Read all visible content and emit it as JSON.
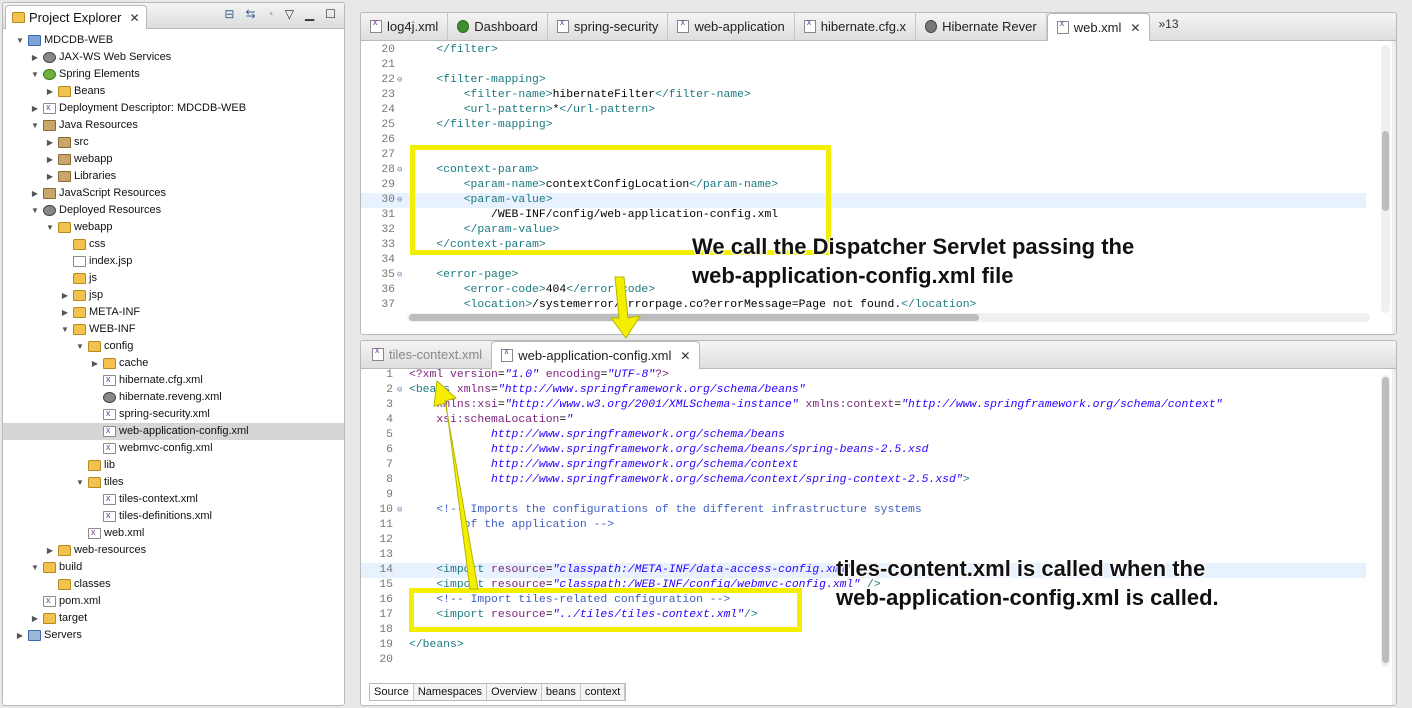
{
  "explorer": {
    "title": "Project Explorer",
    "tree": [
      {
        "label": "MDCDB-WEB",
        "depth": 0,
        "open": true,
        "icon": "proj"
      },
      {
        "label": "JAX-WS Web Services",
        "depth": 1,
        "open": false,
        "icon": "gear"
      },
      {
        "label": "Spring Elements",
        "depth": 1,
        "open": true,
        "icon": "spring"
      },
      {
        "label": "Beans",
        "depth": 2,
        "open": false,
        "icon": "folder"
      },
      {
        "label": "Deployment Descriptor: MDCDB-WEB",
        "depth": 1,
        "open": false,
        "icon": "xml"
      },
      {
        "label": "Java Resources",
        "depth": 1,
        "open": true,
        "icon": "pkg"
      },
      {
        "label": "src",
        "depth": 2,
        "open": false,
        "icon": "pkg"
      },
      {
        "label": "webapp",
        "depth": 2,
        "open": false,
        "icon": "pkg"
      },
      {
        "label": "Libraries",
        "depth": 2,
        "open": false,
        "icon": "pkg"
      },
      {
        "label": "JavaScript Resources",
        "depth": 1,
        "open": false,
        "icon": "pkg"
      },
      {
        "label": "Deployed Resources",
        "depth": 1,
        "open": true,
        "icon": "gear"
      },
      {
        "label": "webapp",
        "depth": 2,
        "open": true,
        "icon": "folder"
      },
      {
        "label": "css",
        "depth": 3,
        "open": null,
        "icon": "folder"
      },
      {
        "label": "index.jsp",
        "depth": 3,
        "open": null,
        "icon": "jsp"
      },
      {
        "label": "js",
        "depth": 3,
        "open": null,
        "icon": "folder"
      },
      {
        "label": "jsp",
        "depth": 3,
        "open": false,
        "icon": "folder"
      },
      {
        "label": "META-INF",
        "depth": 3,
        "open": false,
        "icon": "folder"
      },
      {
        "label": "WEB-INF",
        "depth": 3,
        "open": true,
        "icon": "folder"
      },
      {
        "label": "config",
        "depth": 4,
        "open": true,
        "icon": "folder"
      },
      {
        "label": "cache",
        "depth": 5,
        "open": false,
        "icon": "folder"
      },
      {
        "label": "hibernate.cfg.xml",
        "depth": 5,
        "open": null,
        "icon": "xml"
      },
      {
        "label": "hibernate.reveng.xml",
        "depth": 5,
        "open": null,
        "icon": "gear"
      },
      {
        "label": "spring-security.xml",
        "depth": 5,
        "open": null,
        "icon": "xml"
      },
      {
        "label": "web-application-config.xml",
        "depth": 5,
        "open": null,
        "icon": "xml",
        "selected": true
      },
      {
        "label": "webmvc-config.xml",
        "depth": 5,
        "open": null,
        "icon": "xml"
      },
      {
        "label": "lib",
        "depth": 4,
        "open": null,
        "icon": "folder"
      },
      {
        "label": "tiles",
        "depth": 4,
        "open": true,
        "icon": "folder"
      },
      {
        "label": "tiles-context.xml",
        "depth": 5,
        "open": null,
        "icon": "xml"
      },
      {
        "label": "tiles-definitions.xml",
        "depth": 5,
        "open": null,
        "icon": "xml"
      },
      {
        "label": "web.xml",
        "depth": 4,
        "open": null,
        "icon": "xml"
      },
      {
        "label": "web-resources",
        "depth": 2,
        "open": false,
        "icon": "folder"
      },
      {
        "label": "build",
        "depth": 1,
        "open": true,
        "icon": "folder"
      },
      {
        "label": "classes",
        "depth": 2,
        "open": null,
        "icon": "folder"
      },
      {
        "label": "pom.xml",
        "depth": 1,
        "open": null,
        "icon": "xml"
      },
      {
        "label": "target",
        "depth": 1,
        "open": false,
        "icon": "folder"
      },
      {
        "label": "Servers",
        "depth": 0,
        "open": false,
        "icon": "server"
      }
    ]
  },
  "editor_top": {
    "tabs": [
      {
        "label": "log4j.xml",
        "icon": "xml",
        "active": false
      },
      {
        "label": "Dashboard",
        "icon": "dash",
        "active": false
      },
      {
        "label": "spring-security",
        "icon": "xml",
        "active": false
      },
      {
        "label": "web-application",
        "icon": "xml",
        "active": false
      },
      {
        "label": "hibernate.cfg.x",
        "icon": "xml",
        "active": false
      },
      {
        "label": "Hibernate Rever",
        "icon": "gear",
        "active": false
      },
      {
        "label": "web.xml",
        "icon": "xml",
        "active": true
      }
    ],
    "overflow": "»13",
    "lines": [
      {
        "n": "20",
        "fold": false,
        "hl": false,
        "segs": [
          [
            "pl",
            "    "
          ],
          [
            "tag",
            "</filter>"
          ]
        ]
      },
      {
        "n": "21",
        "fold": false,
        "hl": false,
        "segs": []
      },
      {
        "n": "22",
        "fold": true,
        "hl": false,
        "segs": [
          [
            "pl",
            "    "
          ],
          [
            "tag",
            "<filter-mapping>"
          ]
        ]
      },
      {
        "n": "23",
        "fold": false,
        "hl": false,
        "segs": [
          [
            "pl",
            "        "
          ],
          [
            "tag",
            "<filter-name>"
          ],
          [
            "pl",
            "hibernateFilter"
          ],
          [
            "tag",
            "</filter-name>"
          ]
        ]
      },
      {
        "n": "24",
        "fold": false,
        "hl": false,
        "segs": [
          [
            "pl",
            "        "
          ],
          [
            "tag",
            "<url-pattern>"
          ],
          [
            "pl",
            "*"
          ],
          [
            "tag",
            "</url-pattern>"
          ]
        ]
      },
      {
        "n": "25",
        "fold": false,
        "hl": false,
        "segs": [
          [
            "pl",
            "    "
          ],
          [
            "tag",
            "</filter-mapping>"
          ]
        ]
      },
      {
        "n": "26",
        "fold": false,
        "hl": false,
        "segs": []
      },
      {
        "n": "27",
        "fold": false,
        "hl": false,
        "segs": []
      },
      {
        "n": "28",
        "fold": true,
        "hl": false,
        "segs": [
          [
            "pl",
            "    "
          ],
          [
            "tag",
            "<context-param>"
          ]
        ]
      },
      {
        "n": "29",
        "fold": false,
        "hl": false,
        "segs": [
          [
            "pl",
            "        "
          ],
          [
            "tag",
            "<param-name>"
          ],
          [
            "pl",
            "contextConfigLocation"
          ],
          [
            "tag",
            "</param-name>"
          ]
        ]
      },
      {
        "n": "30",
        "fold": true,
        "hl": true,
        "segs": [
          [
            "pl",
            "        "
          ],
          [
            "tag",
            "<param-value>"
          ]
        ]
      },
      {
        "n": "31",
        "fold": false,
        "hl": false,
        "segs": [
          [
            "pl",
            "            /WEB-INF/config/web-application-config.xml"
          ]
        ]
      },
      {
        "n": "32",
        "fold": false,
        "hl": false,
        "segs": [
          [
            "pl",
            "        "
          ],
          [
            "tag",
            "</param-value>"
          ]
        ]
      },
      {
        "n": "33",
        "fold": false,
        "hl": false,
        "segs": [
          [
            "pl",
            "    "
          ],
          [
            "tag",
            "</context-param>"
          ]
        ]
      },
      {
        "n": "34",
        "fold": false,
        "hl": false,
        "segs": []
      },
      {
        "n": "35",
        "fold": true,
        "hl": false,
        "segs": [
          [
            "pl",
            "    "
          ],
          [
            "tag",
            "<error-page>"
          ]
        ]
      },
      {
        "n": "36",
        "fold": false,
        "hl": false,
        "segs": [
          [
            "pl",
            "        "
          ],
          [
            "tag",
            "<error-code>"
          ],
          [
            "pl",
            "404"
          ],
          [
            "tag",
            "</error-code>"
          ]
        ]
      },
      {
        "n": "37",
        "fold": false,
        "hl": false,
        "segs": [
          [
            "pl",
            "        "
          ],
          [
            "tag",
            "<location>"
          ],
          [
            "pl",
            "/systemerror/errorpage.co?errorMessage=Page not found."
          ],
          [
            "tag",
            "</location>"
          ]
        ]
      }
    ]
  },
  "editor_bottom": {
    "tabs": [
      {
        "label": "tiles-context.xml",
        "icon": "xml",
        "active": false
      },
      {
        "label": "web-application-config.xml",
        "icon": "xml",
        "active": true
      }
    ],
    "lines": [
      {
        "n": "1",
        "fold": false,
        "hl": false,
        "segs": [
          [
            "pi",
            "<?xml"
          ],
          [
            "pl",
            " "
          ],
          [
            "an",
            "version"
          ],
          [
            "pl",
            "="
          ],
          [
            "av",
            "\"1.0\""
          ],
          [
            "pl",
            " "
          ],
          [
            "an",
            "encoding"
          ],
          [
            "pl",
            "="
          ],
          [
            "av",
            "\"UTF-8\""
          ],
          [
            "pi",
            "?>"
          ]
        ]
      },
      {
        "n": "2",
        "fold": true,
        "hl": false,
        "segs": [
          [
            "tag",
            "<beans"
          ],
          [
            "pl",
            " "
          ],
          [
            "an",
            "xmlns"
          ],
          [
            "pl",
            "="
          ],
          [
            "av",
            "\"http://www.springframework.org/schema/beans\""
          ]
        ]
      },
      {
        "n": "3",
        "fold": false,
        "hl": false,
        "segs": [
          [
            "pl",
            "    "
          ],
          [
            "an",
            "xmlns:xsi"
          ],
          [
            "pl",
            "="
          ],
          [
            "av",
            "\"http://www.w3.org/2001/XMLSchema-instance\""
          ],
          [
            "pl",
            " "
          ],
          [
            "an",
            "xmlns:context"
          ],
          [
            "pl",
            "="
          ],
          [
            "av",
            "\"http://www.springframework.org/schema/context\""
          ]
        ]
      },
      {
        "n": "4",
        "fold": false,
        "hl": false,
        "segs": [
          [
            "pl",
            "    "
          ],
          [
            "an",
            "xsi:schemaLocation"
          ],
          [
            "pl",
            "="
          ],
          [
            "av",
            "\""
          ]
        ]
      },
      {
        "n": "5",
        "fold": false,
        "hl": false,
        "segs": [
          [
            "av",
            "            http://www.springframework.org/schema/beans"
          ]
        ]
      },
      {
        "n": "6",
        "fold": false,
        "hl": false,
        "segs": [
          [
            "av",
            "            http://www.springframework.org/schema/beans/spring-beans-2.5.xsd"
          ]
        ]
      },
      {
        "n": "7",
        "fold": false,
        "hl": false,
        "segs": [
          [
            "av",
            "            http://www.springframework.org/schema/context"
          ]
        ]
      },
      {
        "n": "8",
        "fold": false,
        "hl": false,
        "segs": [
          [
            "av",
            "            http://www.springframework.org/schema/context/spring-context-2.5.xsd\""
          ],
          [
            "tag",
            ">"
          ]
        ]
      },
      {
        "n": "9",
        "fold": false,
        "hl": false,
        "segs": []
      },
      {
        "n": "10",
        "fold": true,
        "hl": false,
        "segs": [
          [
            "cm",
            "    <!-- Imports the configurations of the different infrastructure systems"
          ]
        ]
      },
      {
        "n": "11",
        "fold": false,
        "hl": false,
        "segs": [
          [
            "cm",
            "        of the application -->"
          ]
        ]
      },
      {
        "n": "12",
        "fold": false,
        "hl": false,
        "segs": []
      },
      {
        "n": "13",
        "fold": false,
        "hl": false,
        "segs": []
      },
      {
        "n": "14",
        "fold": false,
        "hl": true,
        "segs": [
          [
            "pl",
            "    "
          ],
          [
            "tag",
            "<import"
          ],
          [
            "pl",
            " "
          ],
          [
            "an",
            "resource"
          ],
          [
            "pl",
            "="
          ],
          [
            "av",
            "\"classpath:/META-INF/data-access-config.xml\""
          ],
          [
            "pl",
            " "
          ],
          [
            "tag",
            "/>"
          ]
        ]
      },
      {
        "n": "15",
        "fold": false,
        "hl": false,
        "segs": [
          [
            "pl",
            "    "
          ],
          [
            "tag",
            "<import"
          ],
          [
            "pl",
            " "
          ],
          [
            "an",
            "resource"
          ],
          [
            "pl",
            "="
          ],
          [
            "av",
            "\"classpath:/WEB-INF/config/webmvc-config.xml\""
          ],
          [
            "pl",
            " "
          ],
          [
            "tag",
            "/>"
          ]
        ]
      },
      {
        "n": "16",
        "fold": false,
        "hl": false,
        "segs": [
          [
            "cm",
            "    <!-- Import tiles-related configuration -->"
          ]
        ]
      },
      {
        "n": "17",
        "fold": false,
        "hl": false,
        "segs": [
          [
            "pl",
            "    "
          ],
          [
            "tag",
            "<import"
          ],
          [
            "pl",
            " "
          ],
          [
            "an",
            "resource"
          ],
          [
            "pl",
            "="
          ],
          [
            "av",
            "\"../tiles/tiles-context.xml\""
          ],
          [
            "tag",
            "/>"
          ]
        ]
      },
      {
        "n": "18",
        "fold": false,
        "hl": false,
        "segs": []
      },
      {
        "n": "19",
        "fold": false,
        "hl": false,
        "segs": [
          [
            "tag",
            "</beans>"
          ]
        ]
      },
      {
        "n": "20",
        "fold": false,
        "hl": false,
        "segs": []
      }
    ],
    "bottom_tabs": [
      "Source",
      "Namespaces",
      "Overview",
      "beans",
      "context"
    ],
    "active_bottom_tab": "Source"
  },
  "annotations": {
    "callout_top": {
      "line1": "We call the Dispatcher Servlet passing the",
      "line2": "web-application-config.xml file"
    },
    "callout_bottom": {
      "line1": "tiles-content.xml is called when the",
      "line2": "web-application-config.xml is called."
    },
    "highlight_color": "#f4ef00"
  }
}
